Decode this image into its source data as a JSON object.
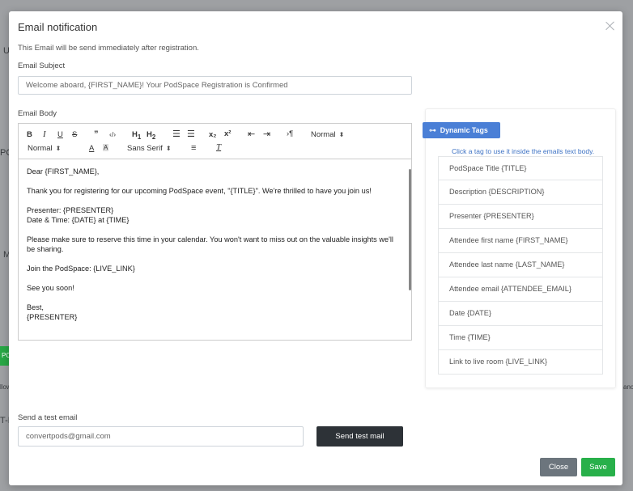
{
  "background": {
    "fragments": [
      "U",
      "PO",
      "M",
      "PO",
      "llow",
      "T-F",
      "anc"
    ]
  },
  "modal": {
    "title": "Email notification",
    "intro": "This Email will be send immediately after registration.",
    "subject_label": "Email Subject",
    "subject_value": "Welcome aboard, {FIRST_NAME}! Your PodSpace Registration is Confirmed",
    "body_label": "Email Body",
    "toolbar": {
      "header_select": "Normal",
      "size_select": "Normal",
      "font_select": "Sans Serif",
      "subscript": "x₂",
      "superscript": "x²"
    },
    "body": [
      "Dear {FIRST_NAME},",
      "Thank you for registering for our upcoming PodSpace event, \"{TITLE}\". We're thrilled to have you join us!",
      "Presenter: {PRESENTER}",
      "Date & Time: {DATE} at {TIME}",
      "Please make sure to reserve this time in your calendar. You won't want to miss out on the valuable insights we'll be sharing.",
      "Join the PodSpace: {LIVE_LINK}",
      "See you soon!",
      "Best,",
      "{PRESENTER}"
    ],
    "tags": {
      "badge": "Dynamic Tags",
      "hint": "Click a tag to use it inside the emails text body.",
      "items": [
        "PodSpace Title {TITLE}",
        "Description {DESCRIPTION}",
        "Presenter {PRESENTER}",
        "Attendee first name {FIRST_NAME}",
        "Attendee last name {LAST_NAME}",
        "Attendee email {ATTENDEE_EMAIL}",
        "Date {DATE}",
        "Time {TIME}",
        "Link to live room {LIVE_LINK}"
      ]
    },
    "test_label": "Send a test email",
    "test_value": "convertpods@gmail.com",
    "send_test_label": "Send test mail",
    "close_label": "Close",
    "save_label": "Save"
  },
  "colors": {
    "overlay": "#9ea0a3",
    "primary": "#4a7fd6",
    "dark_button": "#2d3237",
    "close_button": "#6c757d",
    "save_button": "#28b04a"
  }
}
